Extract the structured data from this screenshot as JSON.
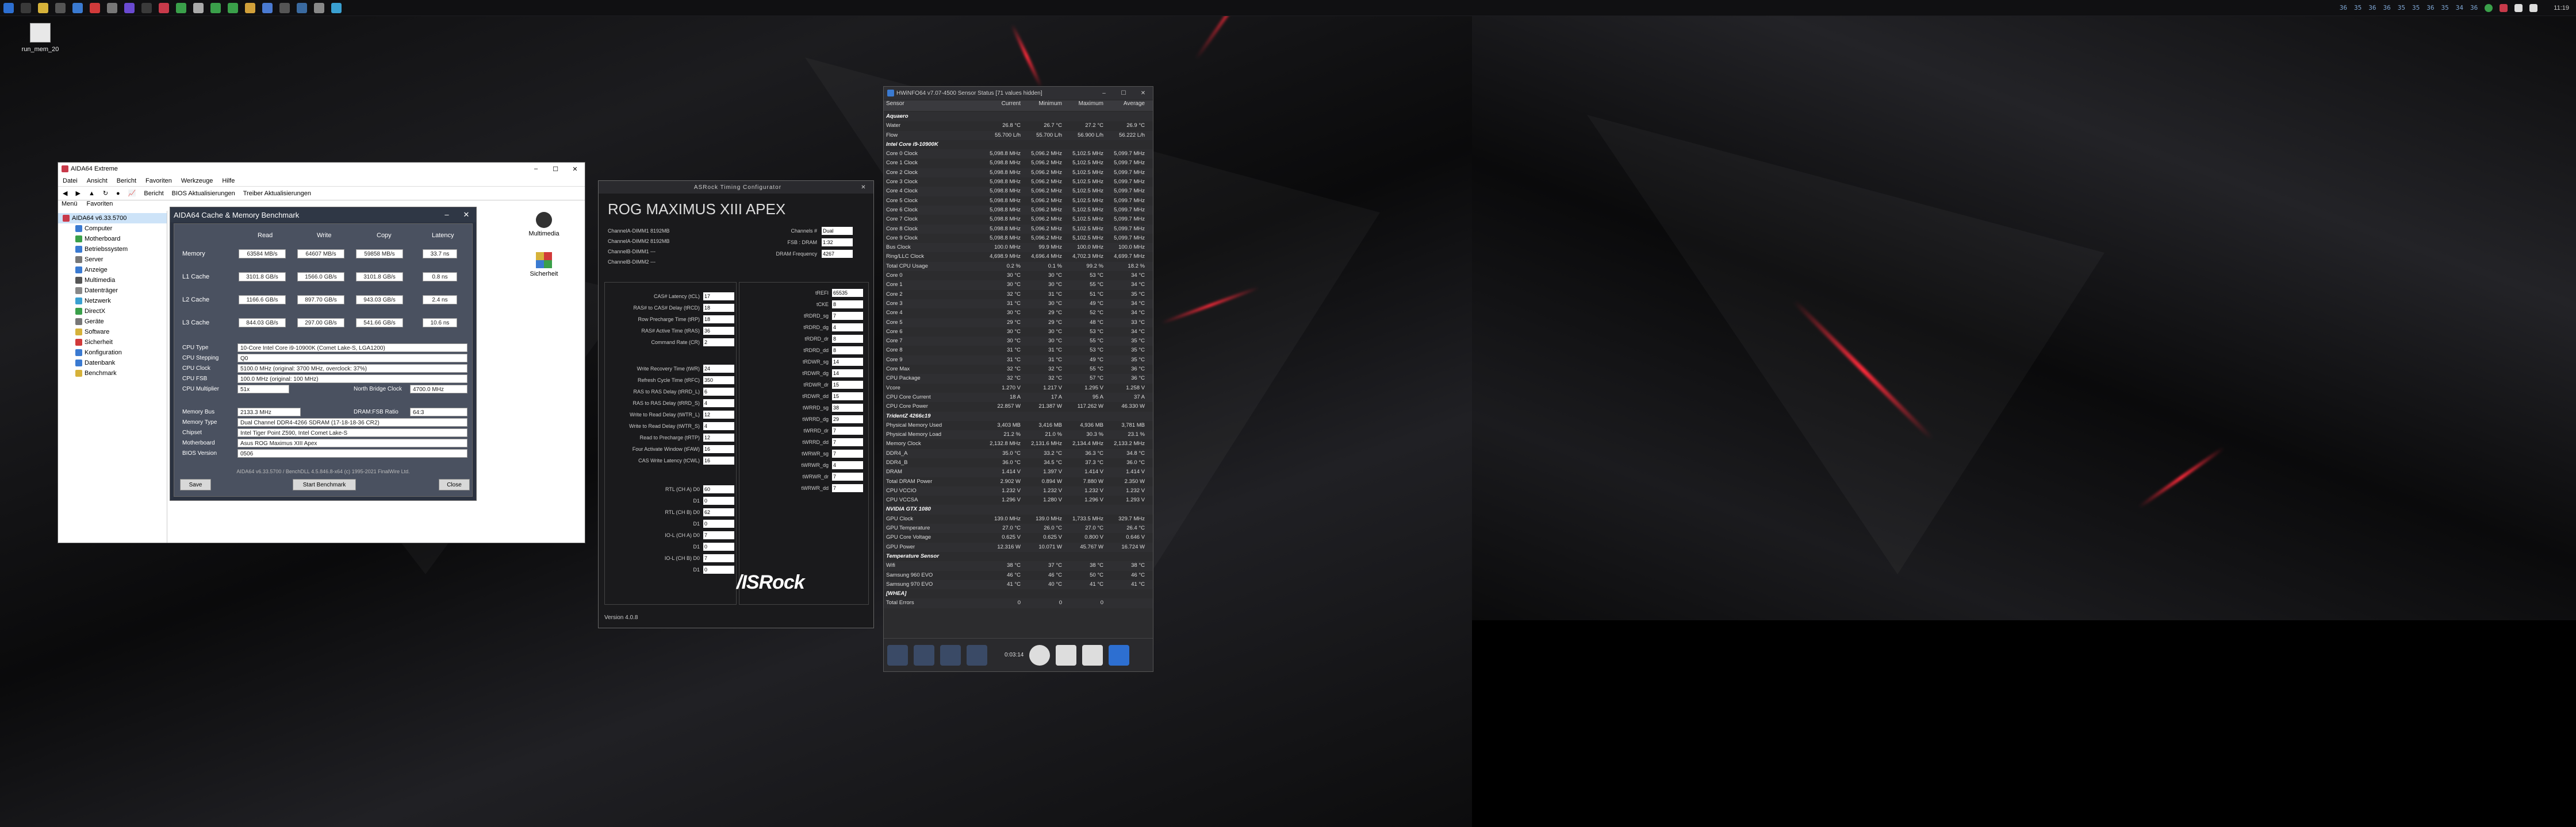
{
  "taskbar": {
    "clock": "11:19",
    "tray_numbers": [
      "36",
      "35",
      "36",
      "36",
      "35",
      "35",
      "36",
      "35",
      "34",
      "36"
    ]
  },
  "desktop_icon": {
    "label": "run_mem_20"
  },
  "aida": {
    "title": "AIDA64 Extreme",
    "menu": [
      "Datei",
      "Ansicht",
      "Bericht",
      "Favoriten",
      "Werkzeuge",
      "Hilfe"
    ],
    "toolbar": [
      "Bericht",
      "BIOS Aktualisierungen",
      "Treiber Aktualisierungen"
    ],
    "tabs": [
      "Menü",
      "Favoriten"
    ],
    "root": "AIDA64 v6.33.5700",
    "tree": [
      "Computer",
      "Motherboard",
      "Betriebssystem",
      "Server",
      "Anzeige",
      "Multimedia",
      "Datenträger",
      "Netzwerk",
      "DirectX",
      "Geräte",
      "Software",
      "Sicherheit",
      "Konfiguration",
      "Datenbank",
      "Benchmark"
    ],
    "panel": [
      "Multimedia",
      "Sicherheit"
    ]
  },
  "bench": {
    "title": "AIDA64 Cache & Memory Benchmark",
    "headers": [
      "Read",
      "Write",
      "Copy",
      "Latency"
    ],
    "rows": [
      {
        "label": "Memory",
        "read": "63584 MB/s",
        "write": "64607 MB/s",
        "copy": "59858 MB/s",
        "lat": "33.7 ns"
      },
      {
        "label": "L1 Cache",
        "read": "3101.8 GB/s",
        "write": "1566.0 GB/s",
        "copy": "3101.8 GB/s",
        "lat": "0.8 ns"
      },
      {
        "label": "L2 Cache",
        "read": "1166.6 GB/s",
        "write": "897.70 GB/s",
        "copy": "943.03 GB/s",
        "lat": "2.4 ns"
      },
      {
        "label": "L3 Cache",
        "read": "844.03 GB/s",
        "write": "297.00 GB/s",
        "copy": "541.66 GB/s",
        "lat": "10.6 ns"
      }
    ],
    "info1": [
      {
        "label": "CPU Type",
        "value": "10-Core Intel Core i9-10900K (Comet Lake-S, LGA1200)"
      },
      {
        "label": "CPU Stepping",
        "value": "Q0"
      },
      {
        "label": "CPU Clock",
        "value": "5100.0 MHz (original: 3700 MHz, overclock: 37%)"
      },
      {
        "label": "CPU FSB",
        "value": "100.0 MHz (original: 100 MHz)"
      },
      {
        "label": "CPU Multiplier",
        "value": "51x"
      }
    ],
    "nb_label": "North Bridge Clock",
    "nb_value": "4700.0 MHz",
    "info2": [
      {
        "label": "Memory Bus",
        "value": "2133.3 MHz"
      },
      {
        "label": "Memory Type",
        "value": "Dual Channel DDR4-4266 SDRAM (17-18-18-36 CR2)"
      },
      {
        "label": "Chipset",
        "value": "Intel Tiger Point Z590, Intel Comet Lake-S"
      },
      {
        "label": "Motherboard",
        "value": "Asus ROG Maximus XIII Apex"
      },
      {
        "label": "BIOS Version",
        "value": "0506"
      }
    ],
    "ratio_label": "DRAM:FSB Ratio",
    "ratio_value": "64:3",
    "footer": "AIDA64 v6.33.5700 / BenchDLL 4.5.846.8-x64  (c) 1995-2021 FinalWire Ltd.",
    "btn_save": "Save",
    "btn_start": "Start Benchmark",
    "btn_close": "Close"
  },
  "asrock": {
    "title": "ASRock Timing Configurator",
    "board": "ROG MAXIMUS XIII APEX",
    "slots": [
      "ChannelA-DIMM1  8192MB",
      "ChannelA-DIMM2  8192MB",
      "ChannelB-DIMM1  ---",
      "ChannelB-DIMM2  ---"
    ],
    "right_top": [
      {
        "label": "Channels #",
        "value": "Dual"
      },
      {
        "label": "FSB : DRAM",
        "value": "1:32"
      },
      {
        "label": "DRAM Frequency",
        "value": "4267"
      }
    ],
    "left_timings": [
      {
        "label": "CAS# Latency (tCL)",
        "value": "17"
      },
      {
        "label": "RAS# to CAS# Delay (tRCD)",
        "value": "18"
      },
      {
        "label": "Row Precharge Time (tRP)",
        "value": "18"
      },
      {
        "label": "RAS# Active Time (tRAS)",
        "value": "36"
      },
      {
        "label": "Command Rate (CR)",
        "value": "2"
      }
    ],
    "left_timings2": [
      {
        "label": "Write Recovery Time (tWR)",
        "value": "24"
      },
      {
        "label": "Refresh Cycle Time (tRFC)",
        "value": "350"
      },
      {
        "label": "RAS to RAS Delay (tRRD_L)",
        "value": "6"
      },
      {
        "label": "RAS to RAS Delay (tRRD_S)",
        "value": "4"
      },
      {
        "label": "Write to Read Delay (tWTR_L)",
        "value": "12"
      },
      {
        "label": "Write to Read Delay (tWTR_S)",
        "value": "4"
      },
      {
        "label": "Read to Precharge (tRTP)",
        "value": "12"
      },
      {
        "label": "Four Activate Window (tFAW)",
        "value": "16"
      },
      {
        "label": "CAS Write Latency (tCWL)",
        "value": "16"
      }
    ],
    "left_timings3": [
      {
        "label": "RTL (CH A) D0",
        "value": "60"
      },
      {
        "label": "D1",
        "value": "0"
      },
      {
        "label": "RTL (CH B) D0",
        "value": "62"
      },
      {
        "label": "D1",
        "value": "0"
      },
      {
        "label": "IO-L (CH A) D0",
        "value": "7"
      },
      {
        "label": "D1",
        "value": "0"
      },
      {
        "label": "IO-L (CH B) D0",
        "value": "7"
      },
      {
        "label": "D1",
        "value": "0"
      }
    ],
    "right_timings": [
      {
        "label": "tREFI",
        "value": "65535"
      },
      {
        "label": "tCKE",
        "value": "8"
      },
      {
        "label": "tRDRD_sg",
        "value": "7"
      },
      {
        "label": "tRDRD_dg",
        "value": "4"
      },
      {
        "label": "tRDRD_dr",
        "value": "8"
      },
      {
        "label": "tRDRD_dd",
        "value": "8"
      },
      {
        "label": "tRDWR_sg",
        "value": "14"
      },
      {
        "label": "tRDWR_dg",
        "value": "14"
      },
      {
        "label": "tRDWR_dr",
        "value": "15"
      },
      {
        "label": "tRDWR_dd",
        "value": "15"
      },
      {
        "label": "tWRRD_sg",
        "value": "38"
      },
      {
        "label": "tWRRD_dg",
        "value": "29"
      },
      {
        "label": "tWRRD_dr",
        "value": "7"
      },
      {
        "label": "tWRRD_dd",
        "value": "7"
      },
      {
        "label": "tWRWR_sg",
        "value": "7"
      },
      {
        "label": "tWRWR_dg",
        "value": "4"
      },
      {
        "label": "tWRWR_dr",
        "value": "7"
      },
      {
        "label": "tWRWR_dd",
        "value": "7"
      }
    ],
    "logo": "/ISRock",
    "version": "Version 4.0.8"
  },
  "hwinfo": {
    "title": "HWiNFO64 v7.07-4500 Sensor Status [71 values hidden]",
    "headers": [
      "Sensor",
      "Current",
      "Minimum",
      "Maximum",
      "Average"
    ],
    "rows": [
      {
        "g": true,
        "n": "Aquaero"
      },
      {
        "n": "Water",
        "c": "26.8 °C",
        "mi": "26.7 °C",
        "ma": "27.2 °C",
        "av": "26.9 °C"
      },
      {
        "n": "Flow",
        "c": "55.700 L/h",
        "mi": "55.700 L/h",
        "ma": "56.900 L/h",
        "av": "56.222 L/h"
      },
      {
        "g": true,
        "n": "Intel Core i9-10900K"
      },
      {
        "n": "Core 0 Clock",
        "c": "5,098.8 MHz",
        "mi": "5,096.2 MHz",
        "ma": "5,102.5 MHz",
        "av": "5,099.7 MHz"
      },
      {
        "n": "Core 1 Clock",
        "c": "5,098.8 MHz",
        "mi": "5,096.2 MHz",
        "ma": "5,102.5 MHz",
        "av": "5,099.7 MHz"
      },
      {
        "n": "Core 2 Clock",
        "c": "5,098.8 MHz",
        "mi": "5,096.2 MHz",
        "ma": "5,102.5 MHz",
        "av": "5,099.7 MHz"
      },
      {
        "n": "Core 3 Clock",
        "c": "5,098.8 MHz",
        "mi": "5,096.2 MHz",
        "ma": "5,102.5 MHz",
        "av": "5,099.7 MHz"
      },
      {
        "n": "Core 4 Clock",
        "c": "5,098.8 MHz",
        "mi": "5,096.2 MHz",
        "ma": "5,102.5 MHz",
        "av": "5,099.7 MHz"
      },
      {
        "n": "Core 5 Clock",
        "c": "5,098.8 MHz",
        "mi": "5,096.2 MHz",
        "ma": "5,102.5 MHz",
        "av": "5,099.7 MHz"
      },
      {
        "n": "Core 6 Clock",
        "c": "5,098.8 MHz",
        "mi": "5,096.2 MHz",
        "ma": "5,102.5 MHz",
        "av": "5,099.7 MHz"
      },
      {
        "n": "Core 7 Clock",
        "c": "5,098.8 MHz",
        "mi": "5,096.2 MHz",
        "ma": "5,102.5 MHz",
        "av": "5,099.7 MHz"
      },
      {
        "n": "Core 8 Clock",
        "c": "5,098.8 MHz",
        "mi": "5,096.2 MHz",
        "ma": "5,102.5 MHz",
        "av": "5,099.7 MHz"
      },
      {
        "n": "Core 9 Clock",
        "c": "5,098.8 MHz",
        "mi": "5,096.2 MHz",
        "ma": "5,102.5 MHz",
        "av": "5,099.7 MHz"
      },
      {
        "n": "Bus Clock",
        "c": "100.0 MHz",
        "mi": "99.9 MHz",
        "ma": "100.0 MHz",
        "av": "100.0 MHz"
      },
      {
        "n": "Ring/LLC Clock",
        "c": "4,698.9 MHz",
        "mi": "4,696.4 MHz",
        "ma": "4,702.3 MHz",
        "av": "4,699.7 MHz"
      },
      {
        "n": "Total CPU Usage",
        "c": "0.2 %",
        "mi": "0.1 %",
        "ma": "99.2 %",
        "av": "18.2 %"
      },
      {
        "n": "Core 0",
        "c": "30 °C",
        "mi": "30 °C",
        "ma": "53 °C",
        "av": "34 °C"
      },
      {
        "n": "Core 1",
        "c": "30 °C",
        "mi": "30 °C",
        "ma": "55 °C",
        "av": "34 °C"
      },
      {
        "n": "Core 2",
        "c": "32 °C",
        "mi": "31 °C",
        "ma": "51 °C",
        "av": "35 °C"
      },
      {
        "n": "Core 3",
        "c": "31 °C",
        "mi": "30 °C",
        "ma": "49 °C",
        "av": "34 °C"
      },
      {
        "n": "Core 4",
        "c": "30 °C",
        "mi": "29 °C",
        "ma": "52 °C",
        "av": "34 °C"
      },
      {
        "n": "Core 5",
        "c": "29 °C",
        "mi": "29 °C",
        "ma": "48 °C",
        "av": "33 °C"
      },
      {
        "n": "Core 6",
        "c": "30 °C",
        "mi": "30 °C",
        "ma": "53 °C",
        "av": "34 °C"
      },
      {
        "n": "Core 7",
        "c": "30 °C",
        "mi": "30 °C",
        "ma": "55 °C",
        "av": "35 °C"
      },
      {
        "n": "Core 8",
        "c": "31 °C",
        "mi": "31 °C",
        "ma": "53 °C",
        "av": "35 °C"
      },
      {
        "n": "Core 9",
        "c": "31 °C",
        "mi": "31 °C",
        "ma": "49 °C",
        "av": "35 °C"
      },
      {
        "n": "Core Max",
        "c": "32 °C",
        "mi": "32 °C",
        "ma": "55 °C",
        "av": "36 °C"
      },
      {
        "n": "CPU Package",
        "c": "32 °C",
        "mi": "32 °C",
        "ma": "57 °C",
        "av": "36 °C"
      },
      {
        "n": "Vcore",
        "c": "1.270 V",
        "mi": "1.217 V",
        "ma": "1.295 V",
        "av": "1.258 V"
      },
      {
        "n": "CPU Core Current",
        "c": "18 A",
        "mi": "17 A",
        "ma": "95 A",
        "av": "37 A"
      },
      {
        "n": "CPU Core Power",
        "c": "22.857 W",
        "mi": "21.387 W",
        "ma": "117.262 W",
        "av": "46.330 W"
      },
      {
        "g": true,
        "n": "TridentZ 4266c19"
      },
      {
        "n": "Physical Memory Used",
        "c": "3,403 MB",
        "mi": "3,416 MB",
        "ma": "4,936 MB",
        "av": "3,781 MB"
      },
      {
        "n": "Physical Memory Load",
        "c": "21.2 %",
        "mi": "21.0 %",
        "ma": "30.3 %",
        "av": "23.1 %"
      },
      {
        "n": "Memory Clock",
        "c": "2,132.8 MHz",
        "mi": "2,131.6 MHz",
        "ma": "2,134.4 MHz",
        "av": "2,133.2 MHz"
      },
      {
        "n": "DDR4_A",
        "c": "35.0 °C",
        "mi": "33.2 °C",
        "ma": "36.3 °C",
        "av": "34.8 °C"
      },
      {
        "n": "DDR4_B",
        "c": "36.0 °C",
        "mi": "34.5 °C",
        "ma": "37.3 °C",
        "av": "36.0 °C"
      },
      {
        "n": "DRAM",
        "c": "1.414 V",
        "mi": "1.397 V",
        "ma": "1.414 V",
        "av": "1.414 V"
      },
      {
        "n": "Total DRAM Power",
        "c": "2.902 W",
        "mi": "0.894 W",
        "ma": "7.880 W",
        "av": "2.350 W"
      },
      {
        "n": "CPU VCCIO",
        "c": "1.232 V",
        "mi": "1.232 V",
        "ma": "1.232 V",
        "av": "1.232 V"
      },
      {
        "n": "CPU VCCSA",
        "c": "1.296 V",
        "mi": "1.280 V",
        "ma": "1.296 V",
        "av": "1.293 V"
      },
      {
        "g": true,
        "n": "NVIDIA GTX 1080"
      },
      {
        "n": "GPU Clock",
        "c": "139.0 MHz",
        "mi": "139.0 MHz",
        "ma": "1,733.5 MHz",
        "av": "329.7 MHz"
      },
      {
        "n": "GPU Temperature",
        "c": "27.0 °C",
        "mi": "26.0 °C",
        "ma": "27.0 °C",
        "av": "26.4 °C"
      },
      {
        "n": "GPU Core Voltage",
        "c": "0.625 V",
        "mi": "0.625 V",
        "ma": "0.800 V",
        "av": "0.646 V"
      },
      {
        "n": "GPU Power",
        "c": "12.316 W",
        "mi": "10.071 W",
        "ma": "45.767 W",
        "av": "16.724 W"
      },
      {
        "g": true,
        "n": "Temperature Sensor"
      },
      {
        "n": "Wifi",
        "c": "38 °C",
        "mi": "37 °C",
        "ma": "38 °C",
        "av": "38 °C"
      },
      {
        "n": "Samsung 960 EVO",
        "c": "46 °C",
        "mi": "46 °C",
        "ma": "50 °C",
        "av": "46 °C"
      },
      {
        "n": "Samsung 970 EVO",
        "c": "41 °C",
        "mi": "40 °C",
        "ma": "41 °C",
        "av": "41 °C"
      },
      {
        "g": true,
        "n": "[WHEA]"
      },
      {
        "n": "Total Errors",
        "c": "0",
        "mi": "0",
        "ma": "0",
        "av": ""
      }
    ],
    "timer": "0:03:14"
  }
}
